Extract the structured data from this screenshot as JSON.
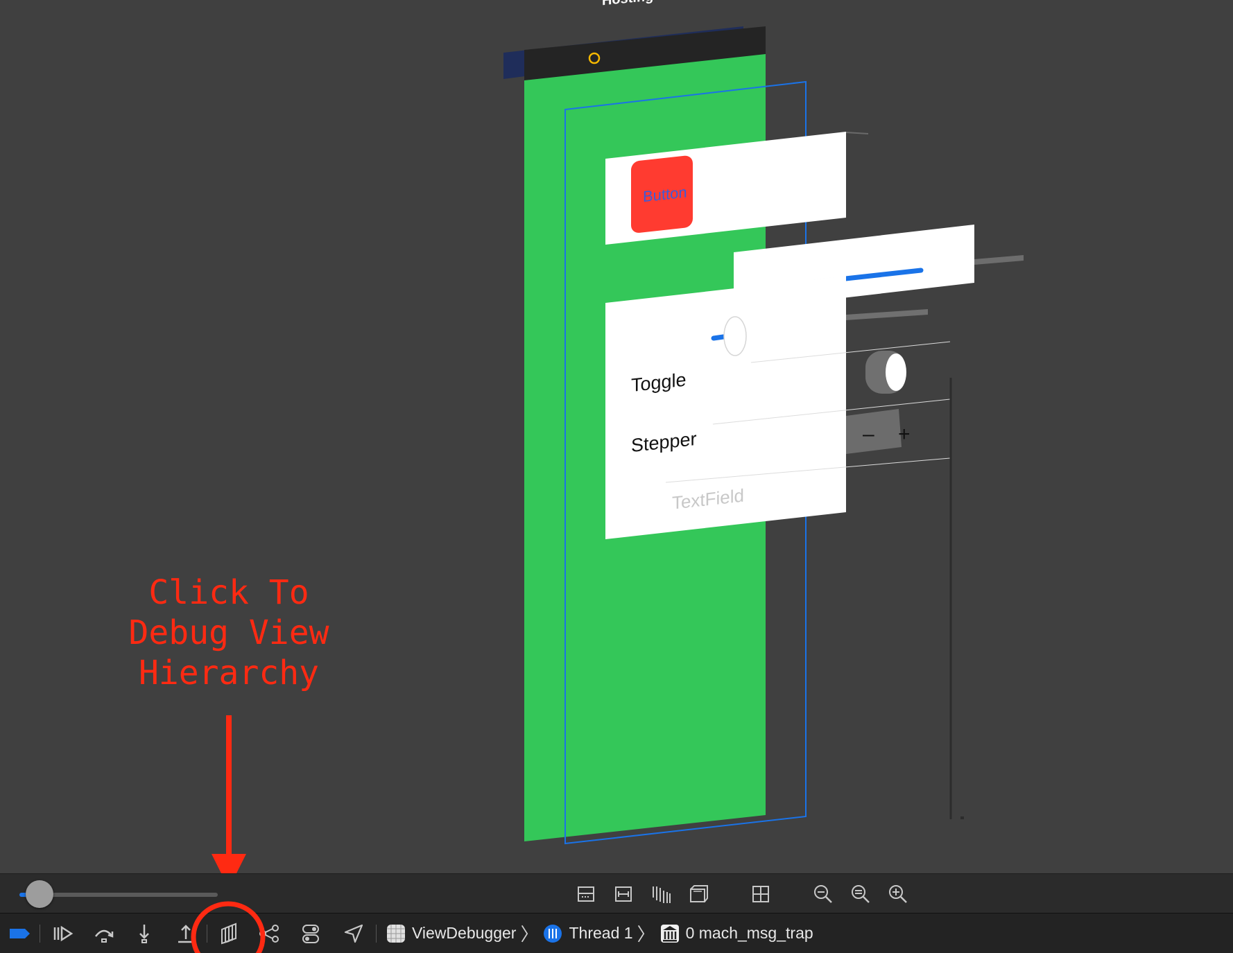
{
  "scene": {
    "header_label": "Hosting View Controller",
    "button_label": "Button",
    "toggle_label": "Toggle",
    "stepper_label": "Stepper",
    "stepper_minus": "–",
    "stepper_plus": "+",
    "textfield_placeholder": "TextField"
  },
  "annotation": {
    "text": "Click To\nDebug View\nHierarchy",
    "color": "#ff2a12"
  },
  "zoom_bar": {
    "slider_value": 0.1,
    "buttons": [
      "show-clipped-content-icon",
      "show-constraints-icon",
      "change-spacing-icon",
      "orient-3d-icon",
      "adjust-view-mode-icon",
      "zoom-out-icon",
      "actual-size-icon",
      "zoom-in-icon"
    ]
  },
  "debug_bar": {
    "buttons": [
      "breakpoints-toggle-icon",
      "continue-icon",
      "step-over-icon",
      "step-into-icon",
      "step-out-icon",
      "debug-view-hierarchy-icon",
      "debug-memory-graph-icon",
      "environment-overrides-icon",
      "simulate-location-icon"
    ],
    "breadcrumbs": [
      {
        "label": "ViewDebugger",
        "icon": "app-icon"
      },
      {
        "label": "Thread 1",
        "icon": "thread-icon"
      },
      {
        "label": "0 mach_msg_trap",
        "icon": "frame-icon"
      }
    ]
  },
  "colors": {
    "canvas": "#404040",
    "green_view": "#34c759",
    "red_button": "#ff3b30",
    "accent": "#1a73e8",
    "annotation_red": "#ff2a12"
  }
}
